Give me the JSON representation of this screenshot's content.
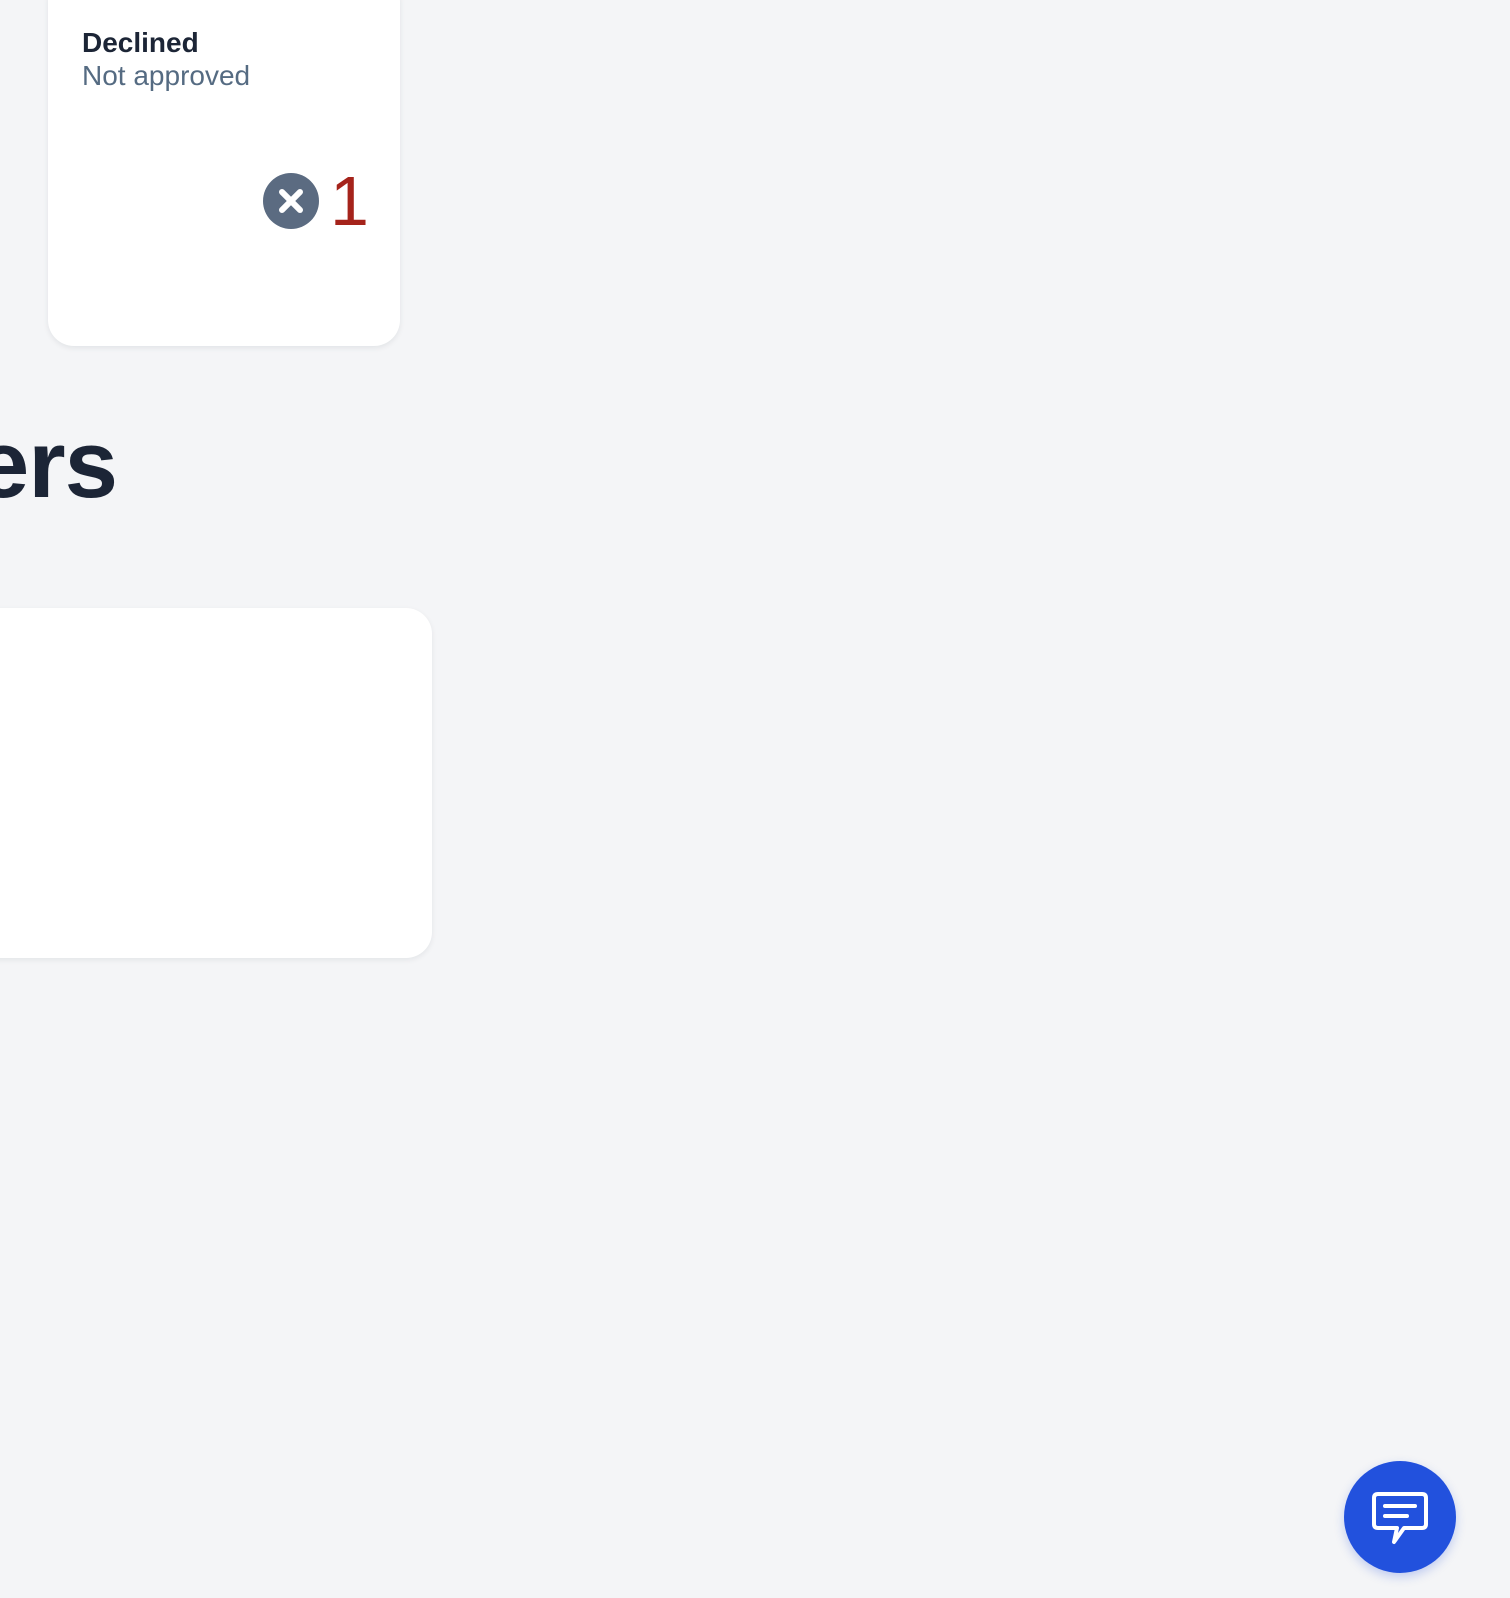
{
  "declined_card": {
    "title": "Declined",
    "subtitle": "Not approved",
    "count": "1",
    "icon": "x-circle-icon"
  },
  "section": {
    "heading_visible_text": "ers"
  },
  "chat_button": {
    "icon": "chat-icon",
    "color": "#2251dd"
  },
  "colors": {
    "background": "#f4f5f7",
    "heading": "#1c2536",
    "subtitle": "#556b82",
    "count": "#a5231b",
    "icon_bg": "#5b6b81"
  }
}
